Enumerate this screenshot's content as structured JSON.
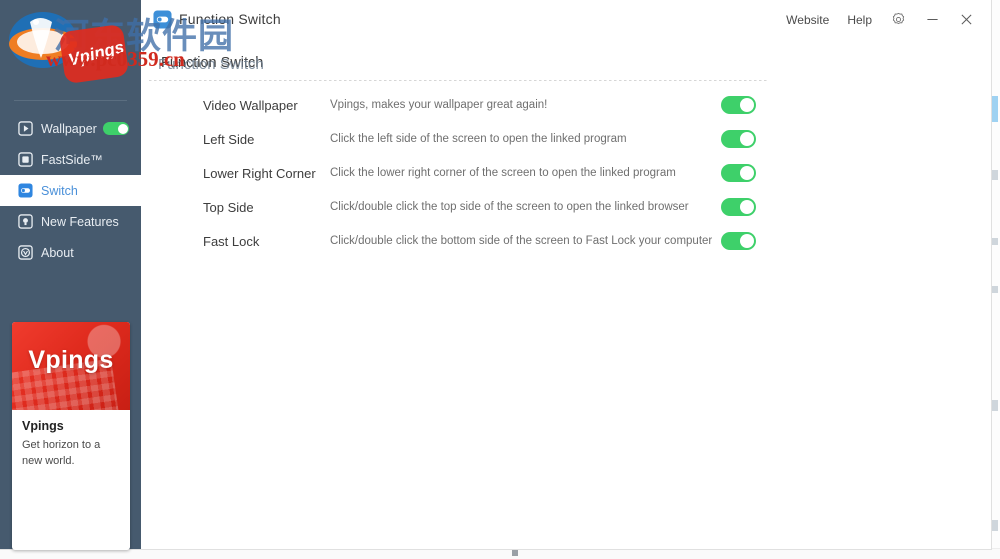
{
  "window": {
    "title": "Function Switch",
    "title_icon": "app-logo-icon",
    "links": [
      {
        "label": "Website",
        "name": "website-link"
      },
      {
        "label": "Help",
        "name": "help-link"
      }
    ],
    "settings_icon": "gear-icon",
    "minimize_icon": "minimize-icon",
    "close_icon": "close-icon"
  },
  "sidebar": {
    "background_color": "#465a6e",
    "items": [
      {
        "label": "Wallpaper",
        "icon": "play-square-icon",
        "active": false,
        "has_toggle": true,
        "toggle_on": true
      },
      {
        "label": "FastSide™",
        "icon": "square-icon",
        "active": false,
        "has_toggle": false
      },
      {
        "label": "Switch",
        "icon": "switch-square-icon",
        "active": true,
        "has_toggle": false
      },
      {
        "label": "New Features",
        "icon": "bulb-icon",
        "active": false,
        "has_toggle": false
      },
      {
        "label": "About",
        "icon": "info-icon",
        "active": false,
        "has_toggle": false
      }
    ],
    "promo": {
      "banner_text": "Vpings",
      "name": "Vpings",
      "description": "Get horizon to a new world.",
      "accent_color": "#e02b1e"
    }
  },
  "content": {
    "section_title": "Function Switch",
    "toggle_on_color": "#3ed06a",
    "rows": [
      {
        "name": "Video Wallpaper",
        "description": "Vpings, makes your wallpaper great again!",
        "toggle_on": true
      },
      {
        "name": "Left Side",
        "description": "Click the left side of the screen to open the linked program",
        "toggle_on": true
      },
      {
        "name": "Lower Right Corner",
        "description": "Click the lower right corner of the screen to open the linked program",
        "toggle_on": true
      },
      {
        "name": "Top Side",
        "description": "Click/double click the top side of the screen to open the linked browser",
        "toggle_on": true
      },
      {
        "name": "Fast Lock",
        "description": "Click/double click the bottom side of the screen to Fast Lock your computer",
        "toggle_on": true
      }
    ]
  },
  "watermark": {
    "chinese_text": "河东软件园",
    "url_text": "www.pc0359.cn",
    "badge_text": "Vpings",
    "ghost_title": "Function Switch"
  }
}
